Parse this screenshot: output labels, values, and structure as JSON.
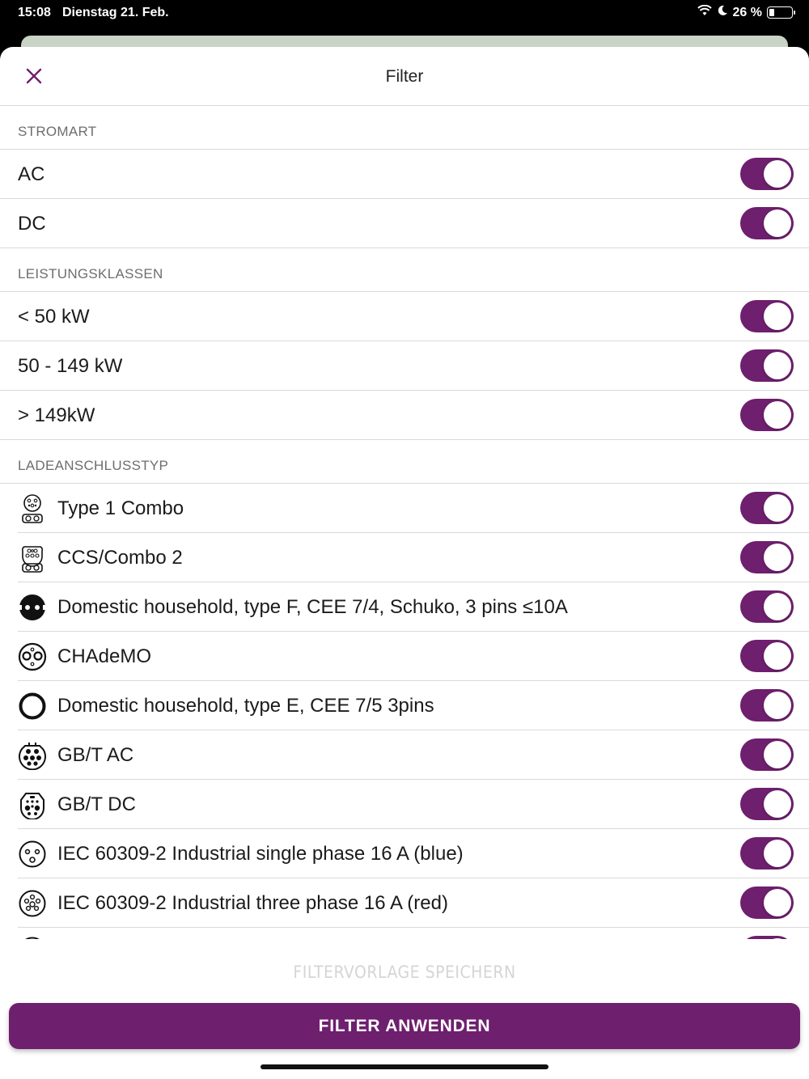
{
  "status_bar": {
    "time": "15:08",
    "date": "Dienstag 21. Feb.",
    "battery": "26 %",
    "battery_level": 0.26
  },
  "header": {
    "title": "Filter"
  },
  "sections": [
    {
      "title": "STROMART",
      "items": [
        {
          "label": "AC",
          "on": true
        },
        {
          "label": "DC",
          "on": true
        }
      ]
    },
    {
      "title": "LEISTUNGSKLASSEN",
      "items": [
        {
          "label": "< 50 kW",
          "on": true
        },
        {
          "label": "50 - 149 kW",
          "on": true
        },
        {
          "label": "> 149kW",
          "on": true
        }
      ]
    },
    {
      "title": "LADEANSCHLUSSTYP",
      "items": [
        {
          "label": "Type 1 Combo",
          "icon": "type1-combo-icon",
          "on": true
        },
        {
          "label": "CCS/Combo 2",
          "icon": "ccs-combo2-icon",
          "on": true
        },
        {
          "label": "Domestic household, type F, CEE 7/4, Schuko, 3 pins ≤10A",
          "icon": "schuko-icon",
          "on": true
        },
        {
          "label": "CHAdeMO",
          "icon": "chademo-icon",
          "on": true
        },
        {
          "label": "Domestic household, type E, CEE 7/5 3pins",
          "icon": "type-e-icon",
          "on": true
        },
        {
          "label": "GB/T AC",
          "icon": "gbt-ac-icon",
          "on": true
        },
        {
          "label": "GB/T DC",
          "icon": "gbt-dc-icon",
          "on": true
        },
        {
          "label": "IEC 60309-2 Industrial single phase 16 A (blue)",
          "icon": "iec-single-phase-icon",
          "on": true
        },
        {
          "label": "IEC 60309-2 Industrial three phase 16 A (red)",
          "icon": "iec-three-phase-icon",
          "on": true
        }
      ]
    }
  ],
  "footer": {
    "save_template": "FILTERVORLAGE SPEICHERN",
    "apply": "FILTER ANWENDEN"
  },
  "colors": {
    "accent": "#6e1f6e",
    "divider": "#d9d9d9"
  }
}
